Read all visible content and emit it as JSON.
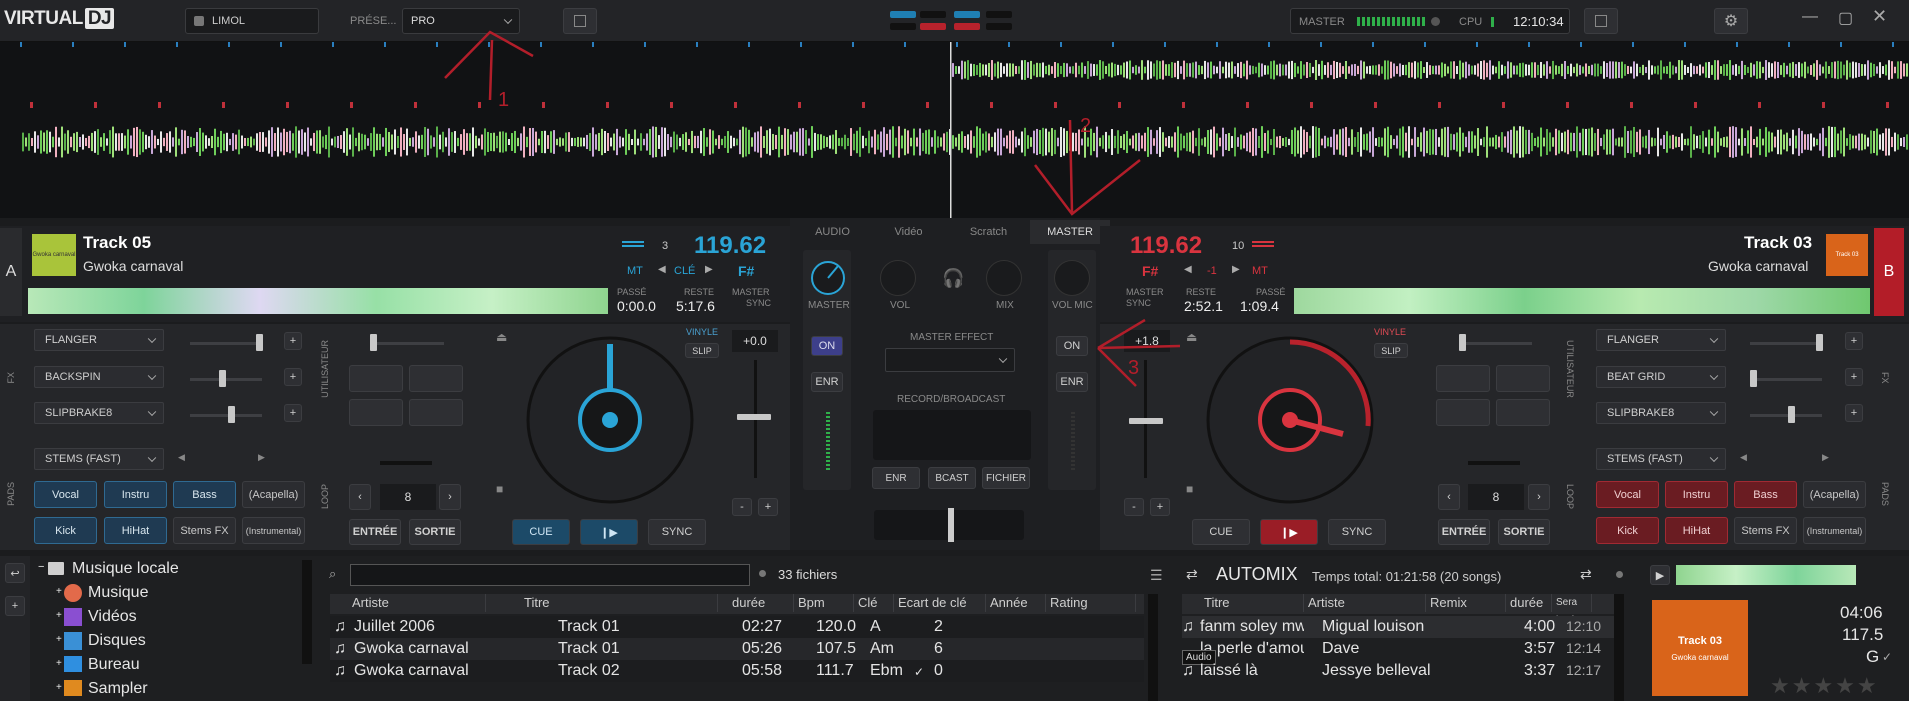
{
  "app": {
    "logo": "VIRTUAL",
    "logo_b": "DJ",
    "user": "LIMOL",
    "preset_label": "PRÉSE...",
    "preset_value": "PRO",
    "master_label": "MASTER",
    "cpu_label": "CPU",
    "clock": "12:10:34"
  },
  "deckA": {
    "letter": "A",
    "title": "Track 05",
    "artist": "Gwoka carnaval",
    "bpm": "119.62",
    "beat_num": "3",
    "mt": "MT",
    "key_label": "CLÉ",
    "key": "F#",
    "passe_label": "PASSÉ",
    "passe": "0:00.0",
    "reste_label": "RESTE",
    "reste": "5:17.6",
    "master_label": "MASTER",
    "sync_label": "SYNC",
    "cover_text": "Gwoka carnaval",
    "fx": [
      "FLANGER",
      "BACKSPIN",
      "SLIPBRAKE8"
    ],
    "fx_label": "FX",
    "user_label": "UTILISATEUR",
    "stems": "STEMS (FAST)",
    "pads_label": "PADS",
    "loop_label": "LOOP",
    "pads": [
      "Vocal",
      "Instru",
      "Bass",
      "(Acapella)",
      "Kick",
      "HiHat",
      "Stems FX",
      "(Instrumental)"
    ],
    "loop_value": "8",
    "in_label": "ENTRÉE",
    "out_label": "SORTIE",
    "vinyl": "VINYLE",
    "slip": "SLIP",
    "pitch": "+0.0",
    "cue": "CUE",
    "sync": "SYNC"
  },
  "deckB": {
    "letter": "B",
    "title": "Track 03",
    "artist": "Gwoka carnaval",
    "bpm": "119.62",
    "beat_num": "10",
    "mt": "MT",
    "key": "F#",
    "key_offset": "-1",
    "passe_label": "PASSÉ",
    "passe": "1:09.4",
    "reste_label": "RESTE",
    "reste": "2:52.1",
    "master_label": "MASTER",
    "sync_label": "SYNC",
    "cover_text": "Track 03",
    "fx": [
      "FLANGER",
      "BEAT GRID",
      "SLIPBRAKE8"
    ],
    "fx_label": "FX",
    "user_label": "UTILISATEUR",
    "stems": "STEMS (FAST)",
    "pads_label": "PADS",
    "loop_label": "LOOP",
    "pads": [
      "Vocal",
      "Instru",
      "Bass",
      "(Acapella)",
      "Kick",
      "HiHat",
      "Stems FX",
      "(Instrumental)"
    ],
    "loop_value": "8",
    "in_label": "ENTRÉE",
    "out_label": "SORTIE",
    "vinyl": "VINYLE",
    "slip": "SLIP",
    "pitch": "+1.8",
    "cue": "CUE",
    "sync": "SYNC"
  },
  "mixer": {
    "tabs": [
      "AUDIO",
      "Vidéo",
      "Scratch",
      "MASTER"
    ],
    "master": "MASTER",
    "vol": "VOL",
    "mix": "MIX",
    "vol_mic": "VOL MIC",
    "on": "ON",
    "enr": "ENR",
    "master_effect": "MASTER EFFECT",
    "record": "RECORD/BROADCAST",
    "rec_btns": [
      "ENR",
      "BCAST",
      "FICHIER"
    ]
  },
  "browser": {
    "tree": [
      "Musique locale",
      "Musique",
      "Vidéos",
      "Disques",
      "Bureau",
      "Sampler"
    ],
    "count": "33 fichiers",
    "columns": [
      "Artiste",
      "Titre",
      "durée",
      "Bpm",
      "Clé",
      "Ecart de clé",
      "Année",
      "Rating"
    ],
    "rows": [
      [
        "Juillet 2006",
        "Track 01",
        "02:27",
        "120.0",
        "A",
        "2"
      ],
      [
        "Gwoka carnaval",
        "Track 01",
        "05:26",
        "107.5",
        "Am",
        "6"
      ],
      [
        "Gwoka carnaval",
        "Track 02",
        "05:58",
        "111.7",
        "Ebm",
        "0"
      ]
    ]
  },
  "automix": {
    "title": "AUTOMIX",
    "total": "Temps total: 01:21:58 (20 songs)",
    "columns": [
      "Titre",
      "Artiste",
      "Remix",
      "durée",
      "Sera joué"
    ],
    "rows": [
      [
        "fanm soley mwen",
        "Migual louison",
        "",
        "4:00",
        "12:10"
      ],
      [
        "la perle d'amour",
        "Dave",
        "",
        "3:57",
        "12:14"
      ],
      [
        "laissé là",
        "Jessye belleval",
        "",
        "3:37",
        "12:17"
      ]
    ],
    "tooltip": "Audio"
  },
  "preview": {
    "time": "04:06",
    "bpm": "117.5",
    "key": "G",
    "cover_title": "Track 03",
    "cover_sub": "Gwoka carnaval"
  },
  "annotations": [
    "1",
    "2",
    "3"
  ]
}
